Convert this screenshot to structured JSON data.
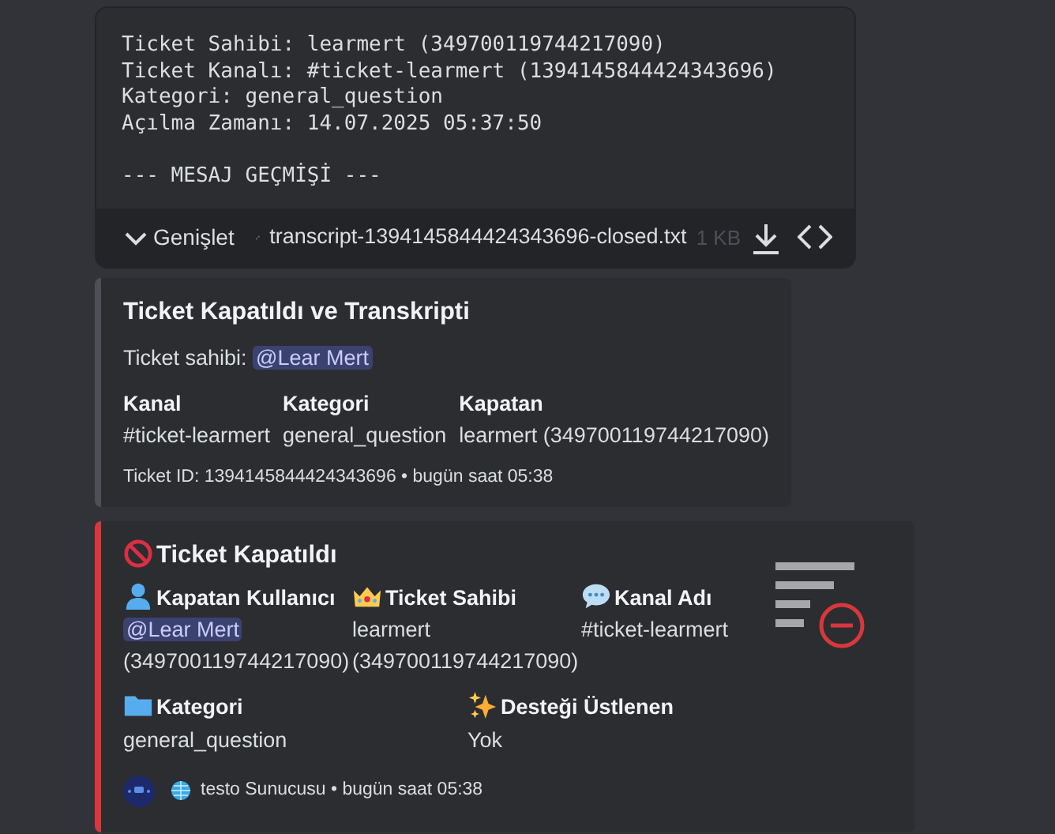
{
  "file_attachment": {
    "lines": [
      "Ticket Sahibi: learmert (349700119744217090)",
      "Ticket Kanalı: #ticket-learmert (1394145844424343696)",
      "Kategori: general_question",
      "Açılma Zamanı: 14.07.2025 05:37:50"
    ],
    "history_line": "--- MESAJ GEÇMİŞİ ---",
    "expand_label": "Genişlet",
    "file_name": "transcript-1394145844424343696-closed.txt",
    "file_size": "1 KB"
  },
  "transcript_embed": {
    "title": "Ticket Kapatıldı ve Transkripti",
    "owner_label": "Ticket sahibi:",
    "owner_mention": "@Lear Mert",
    "fields": [
      {
        "name": "Kanal",
        "value": "#ticket-learmert"
      },
      {
        "name": "Kategori",
        "value": "general_question"
      },
      {
        "name": "Kapatan",
        "value": "learmert (349700119744217090)"
      }
    ],
    "footer": "Ticket ID: 1394145844424343696 • bugün saat 05:38"
  },
  "closed_embed": {
    "title": "Ticket Kapatıldı",
    "color": "#da373c",
    "field_rows": [
      [
        {
          "name": "Kapatan Kullanıcı",
          "mention": "@Lear Mert",
          "value": "(349700119744217090)"
        },
        {
          "name": "Ticket Sahibi",
          "value": "learmert (349700119744217090)"
        },
        {
          "name": "Kanal Adı",
          "value": "#ticket-learmert"
        }
      ],
      [
        {
          "name": "Kategori",
          "value": "general_question"
        },
        {
          "name": "Desteği Üstlenen",
          "value": "Yok"
        }
      ]
    ],
    "footer": "testo Sunucusu • bugün saat 05:38"
  }
}
